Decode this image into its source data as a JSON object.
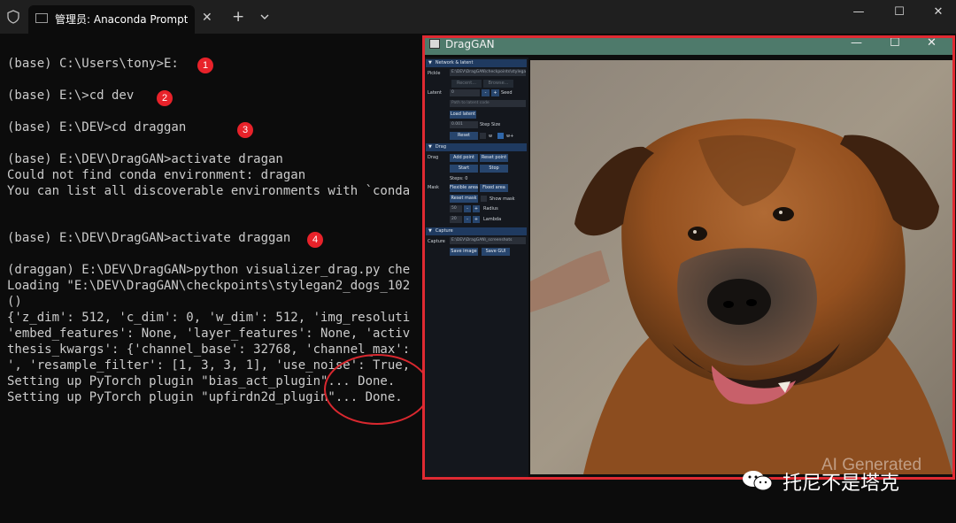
{
  "terminal": {
    "tab_title": "管理员: Anaconda Prompt (Mi",
    "tab_close": "✕",
    "new_tab": "+",
    "window_controls": {
      "minimize": "—",
      "maximize": "☐",
      "close": "✕"
    },
    "lines": [
      "(base) C:\\Users\\tony>E:",
      "(base) E:\\>cd dev",
      "(base) E:\\DEV>cd draggan",
      "(base) E:\\DEV\\DragGAN>activate dragan",
      "Could not find conda environment: dragan",
      "You can list all discoverable environments with `conda",
      "(base) E:\\DEV\\DragGAN>activate draggan",
      "(draggan) E:\\DEV\\DragGAN>python visualizer_drag.py che",
      "Loading \"E:\\DEV\\DragGAN\\checkpoints\\stylegan2_dogs_102",
      "()",
      "{'z_dim': 512, 'c_dim': 0, 'w_dim': 512, 'img_resoluti",
      "'embed_features': None, 'layer_features': None, 'activ",
      "thesis_kwargs': {'channel_base': 32768, 'channel_max':",
      "', 'resample_filter': [1, 3, 3, 1], 'use_noise': True,",
      "Setting up PyTorch plugin \"bias_act_plugin\"... Done.",
      "Setting up PyTorch plugin \"upfirdn2d_plugin\"... Done."
    ],
    "step_badges": [
      "1",
      "2",
      "3",
      "4"
    ]
  },
  "draggan": {
    "title": "DragGAN",
    "window_controls": {
      "minimize": "—",
      "maximize": "☐",
      "close": "✕"
    },
    "sections": {
      "network": "Network & latent",
      "drag": "Drag",
      "capture": "Capture"
    },
    "network": {
      "pickle_label": "Pickle",
      "pickle_value": "E:\\DEV\\DragGAN\\checkpoints\\stylegan",
      "recent_btn": "Recent...",
      "browse_btn": "Browse...",
      "latent_label": "Latent",
      "latent_value": "0",
      "minus": "-",
      "plus": "+",
      "seed_label": "Seed",
      "latent_path_placeholder": "Path to latent code",
      "load_latent_btn": "Load latent",
      "step_size_value": "0.001",
      "step_size_label": "Step Size",
      "reset_btn": "Reset",
      "w_label": "w",
      "wplus_label": "w+"
    },
    "drag": {
      "drag_label": "Drag",
      "add_point_btn": "Add point",
      "reset_point_btn": "Reset point",
      "start_btn": "Start",
      "stop_btn": "Stop",
      "steps_label": "Steps: 0",
      "mask_label": "Mask",
      "flexible_area_btn": "Flexible area",
      "fixed_area_btn": "Fixed area",
      "reset_mask_btn": "Reset mask",
      "show_mask_label": "Show mask",
      "radius_value": "50",
      "radius_label": "Radius",
      "lambda_value": "20",
      "lambda_label": "Lambda"
    },
    "capture": {
      "capture_label": "Capture",
      "path_value": "E:\\DEV\\DragGAN\\_screenshots",
      "save_image_btn": "Save image",
      "save_gui_btn": "Save GUI"
    }
  },
  "watermark": {
    "text": "托尼不是塔克",
    "ai_generated": "AI Generated"
  },
  "colors": {
    "terminal_bg": "#0c0c0c",
    "terminal_text": "#cccccc",
    "draggan_titlebar": "#4e7a6b",
    "highlight_red": "#df2a32",
    "imgui_button": "#27456d",
    "imgui_header": "#1f3a60"
  }
}
